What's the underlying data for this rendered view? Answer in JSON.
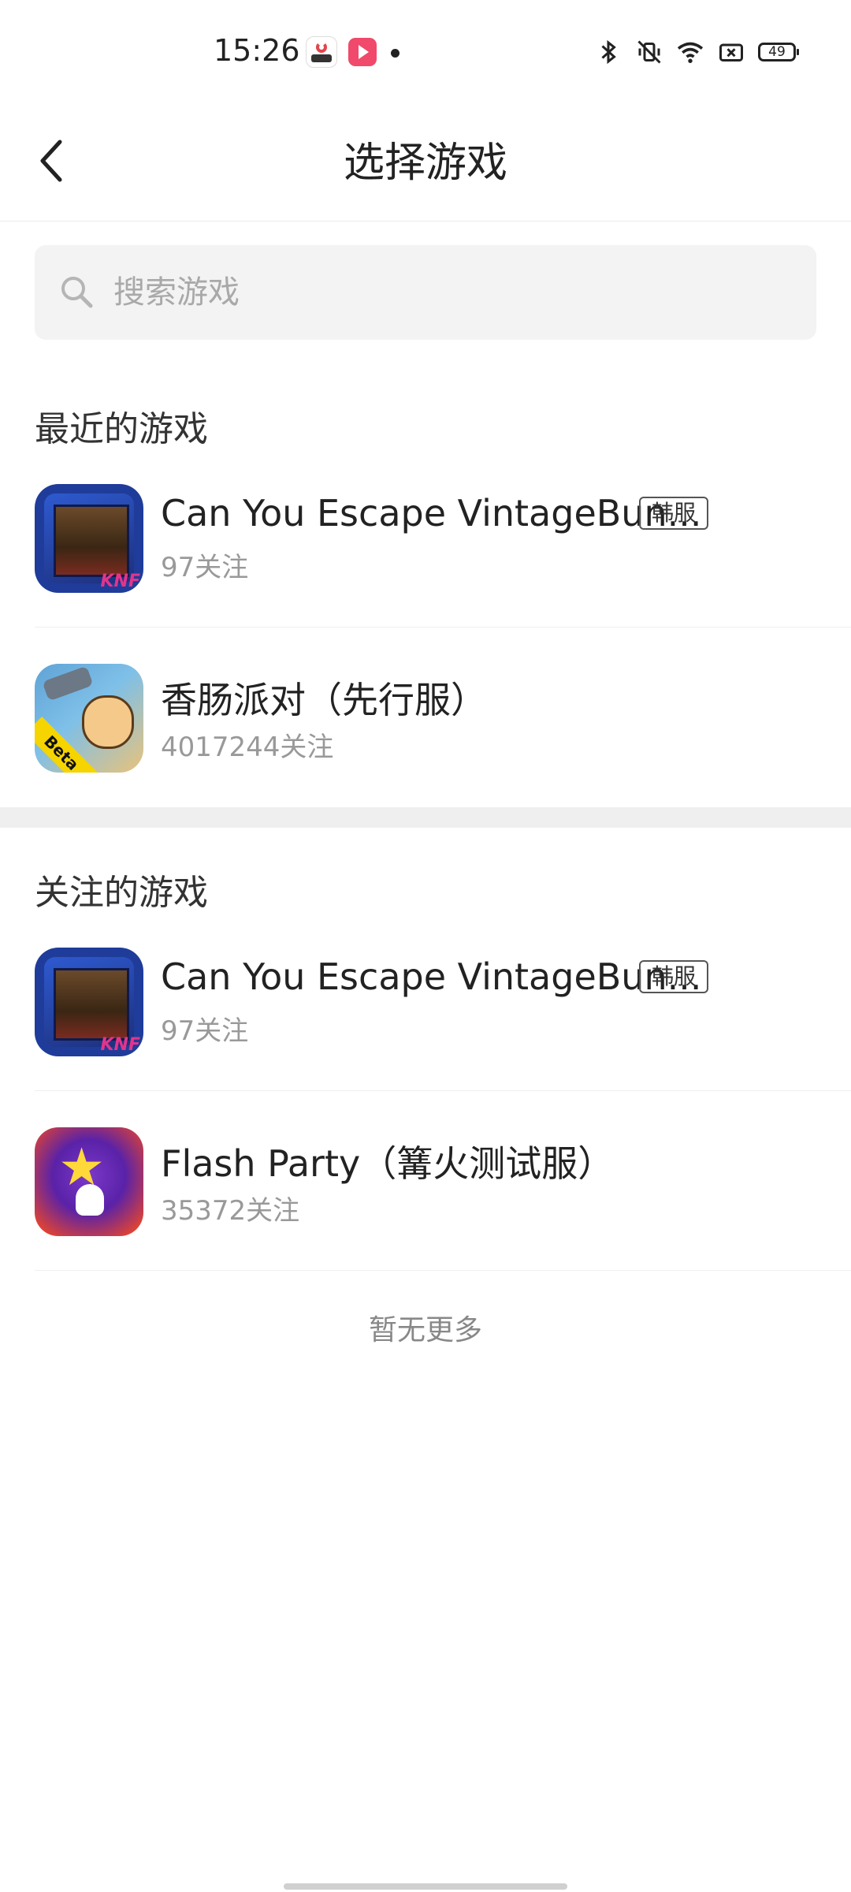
{
  "status_bar": {
    "time": "15:26",
    "icons": [
      "ctrip-app-icon",
      "video-app-icon",
      "notification-dot",
      "bluetooth-icon",
      "vibrate-off-icon",
      "wifi-icon",
      "sim-off-icon",
      "battery-icon"
    ],
    "battery": "49"
  },
  "header": {
    "title": "选择游戏",
    "back_icon": "chevron-left-icon"
  },
  "search": {
    "placeholder": "搜索游戏"
  },
  "recent": {
    "title": "最近的游戏",
    "items": [
      {
        "name": "Can You Escape VintageBun...",
        "tag": "韩服",
        "follow": "97关注",
        "icon": "escape-game-icon"
      },
      {
        "name": "香肠派对（先行服）",
        "follow": "4017244关注",
        "icon": "sausage-party-icon"
      }
    ]
  },
  "followed": {
    "title": "关注的游戏",
    "items": [
      {
        "name": "Can You Escape VintageBun...",
        "tag": "韩服",
        "follow": "97关注",
        "icon": "escape-game-icon"
      },
      {
        "name": "Flash Party（篝火测试服）",
        "follow": "35372关注",
        "icon": "flash-party-icon"
      }
    ]
  },
  "footer": {
    "no_more": "暂无更多"
  },
  "colors": {
    "text_primary": "#222222",
    "text_secondary": "#999999",
    "search_bg": "#f3f3f3",
    "divider": "#efefef"
  }
}
